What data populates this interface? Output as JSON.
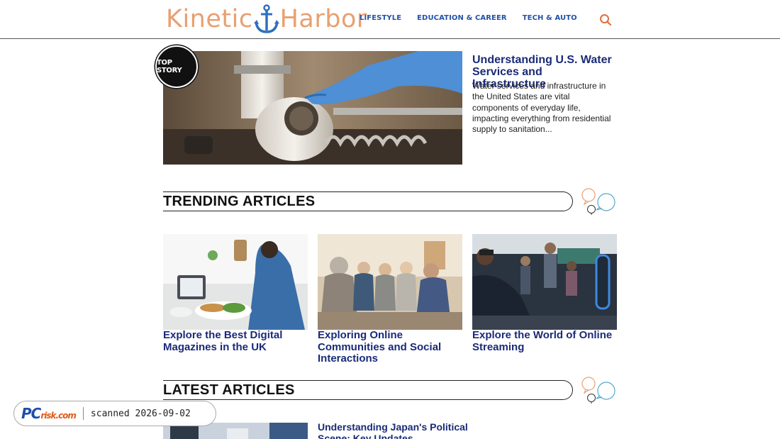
{
  "header": {
    "logo_left": "Kinetic",
    "logo_right": "Harbor",
    "nav": [
      "LIFESTYLE",
      "EDUCATION & CAREER",
      "TECH & AUTO"
    ]
  },
  "top_story": {
    "badge": "TOP STORY",
    "title": "Understanding U.S. Water Services and Infrastructure",
    "excerpt": "Water services and infrastructure in the United States are vital components of everyday life, impacting everything from residential supply to sanitation..."
  },
  "trending": {
    "heading": "TRENDING ARTICLES",
    "articles": [
      {
        "title": "Explore the Best Digital Magazines in the UK"
      },
      {
        "title": "Exploring Online Communities and Social Interactions"
      },
      {
        "title": "Explore the World of Online Streaming"
      }
    ]
  },
  "latest": {
    "heading": "LATEST ARTICLES",
    "articles": [
      {
        "title": "Understanding Japan's Political Scene: Key Updates"
      }
    ]
  },
  "watermark": {
    "brand_main": "PC",
    "brand_sub": "risk.com",
    "text": "scanned 2026-09-02"
  },
  "colors": {
    "logo_orange": "#e8a071",
    "logo_anchor_blue": "#2e6fc0",
    "nav_blue": "#2352a8",
    "title_navy": "#1a2a78",
    "search_orange": "#e0703a",
    "bubble_orange": "#e8a071",
    "bubble_teal": "#5aa8c8"
  },
  "icons": [
    "anchor-icon",
    "search-icon",
    "speech-bubbles-icon"
  ]
}
